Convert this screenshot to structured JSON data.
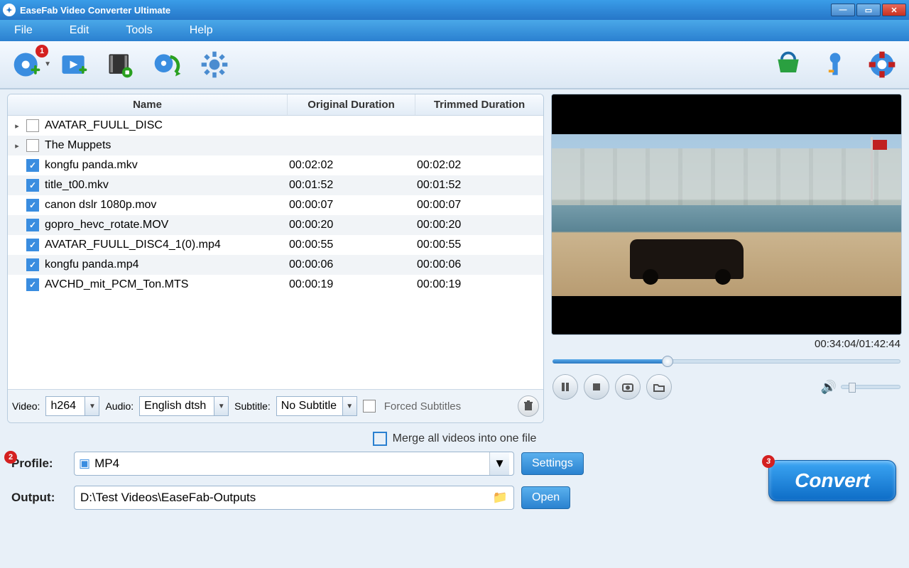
{
  "window": {
    "title": "EaseFab Video Converter Ultimate"
  },
  "menu": {
    "file": "File",
    "edit": "Edit",
    "tools": "Tools",
    "help": "Help"
  },
  "toolbar_badges": {
    "add_disc": "1"
  },
  "table": {
    "headers": {
      "name": "Name",
      "orig": "Original Duration",
      "trim": "Trimmed Duration"
    },
    "rows": [
      {
        "folder": true,
        "checked": false,
        "name": "AVATAR_FUULL_DISC",
        "orig": "",
        "trim": ""
      },
      {
        "folder": true,
        "checked": false,
        "name": "The Muppets",
        "orig": "",
        "trim": ""
      },
      {
        "folder": false,
        "checked": true,
        "name": "kongfu panda.mkv",
        "orig": "00:02:02",
        "trim": "00:02:02"
      },
      {
        "folder": false,
        "checked": true,
        "name": "title_t00.mkv",
        "orig": "00:01:52",
        "trim": "00:01:52"
      },
      {
        "folder": false,
        "checked": true,
        "name": "canon dslr 1080p.mov",
        "orig": "00:00:07",
        "trim": "00:00:07"
      },
      {
        "folder": false,
        "checked": true,
        "name": "gopro_hevc_rotate.MOV",
        "orig": "00:00:20",
        "trim": "00:00:20"
      },
      {
        "folder": false,
        "checked": true,
        "name": "AVATAR_FUULL_DISC4_1(0).mp4",
        "orig": "00:00:55",
        "trim": "00:00:55"
      },
      {
        "folder": false,
        "checked": true,
        "name": "kongfu panda.mp4",
        "orig": "00:00:06",
        "trim": "00:00:06"
      },
      {
        "folder": false,
        "checked": true,
        "name": "AVCHD_mit_PCM_Ton.MTS",
        "orig": "00:00:19",
        "trim": "00:00:19"
      }
    ]
  },
  "streams": {
    "video_label": "Video:",
    "video_value": "h264",
    "audio_label": "Audio:",
    "audio_value": "English dtsh",
    "subtitle_label": "Subtitle:",
    "subtitle_value": "No Subtitle",
    "forced_label": "Forced Subtitles"
  },
  "preview": {
    "time": "00:34:04/01:42:44"
  },
  "merge_label": "Merge all videos into one file",
  "profile": {
    "label": "Profile:",
    "value": "MP4",
    "settings_btn": "Settings",
    "badge": "2"
  },
  "output": {
    "label": "Output:",
    "path": "D:\\Test Videos\\EaseFab-Outputs",
    "open_btn": "Open"
  },
  "convert": {
    "label": "Convert",
    "badge": "3"
  }
}
